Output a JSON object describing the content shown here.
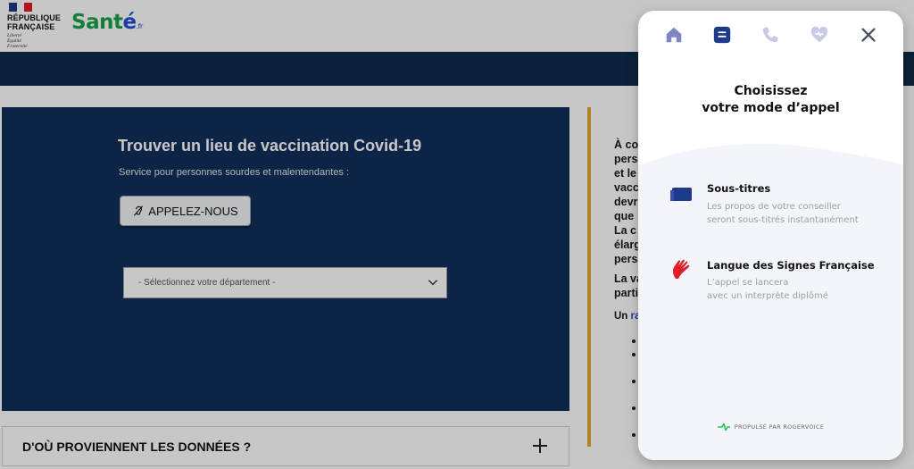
{
  "header": {
    "gov_name_line1": "RÉPUBLIQUE",
    "gov_name_line2": "FRANÇAISE",
    "gov_motto_line1": "Liberté",
    "gov_motto_line2": "Égalité",
    "gov_motto_line3": "Fraternité",
    "sante_part1": "Sant",
    "sante_part2": "é",
    "sante_fr": ".fr"
  },
  "main": {
    "title": "Trouver un lieu de vaccination Covid-19",
    "subtitle": "Service pour personnes sourdes et malentendantes :",
    "call_button": "APPELEZ-NOUS",
    "dept_select_value": "- Sélectionnez votre département -"
  },
  "accordion": {
    "label": "D'OÙ PROVIENNENT LES DONNÉES ?"
  },
  "info": {
    "lines": [
      "À co",
      "pers",
      "et le",
      "vacc",
      "devr",
      "que",
      "La c",
      "élarg",
      "pers"
    ],
    "lines2": [
      "La va",
      "parti"
    ],
    "line3_prefix": "Un ",
    "line3_link": "ra"
  },
  "widget": {
    "title_line1": "Choisissez",
    "title_line2": "votre mode d’appel",
    "options": [
      {
        "title": "Sous-titres",
        "desc_line1": "Les propos de votre conseiller",
        "desc_line2": "seront sous-titrés instantanément"
      },
      {
        "title": "Langue des Signes Française",
        "desc_line1": "L’appel se lancera",
        "desc_line2": "avec un interprète diplômé"
      }
    ],
    "powered_by": "PROPULSÉ PAR ROGERVOICE",
    "colors": {
      "accent": "#1e3a8a",
      "icon_inactive": "#c7cbe6",
      "icon_home": "#7f86c4",
      "lsf_red": "#e11d2a",
      "rogervoice_green": "#22c55e"
    }
  }
}
